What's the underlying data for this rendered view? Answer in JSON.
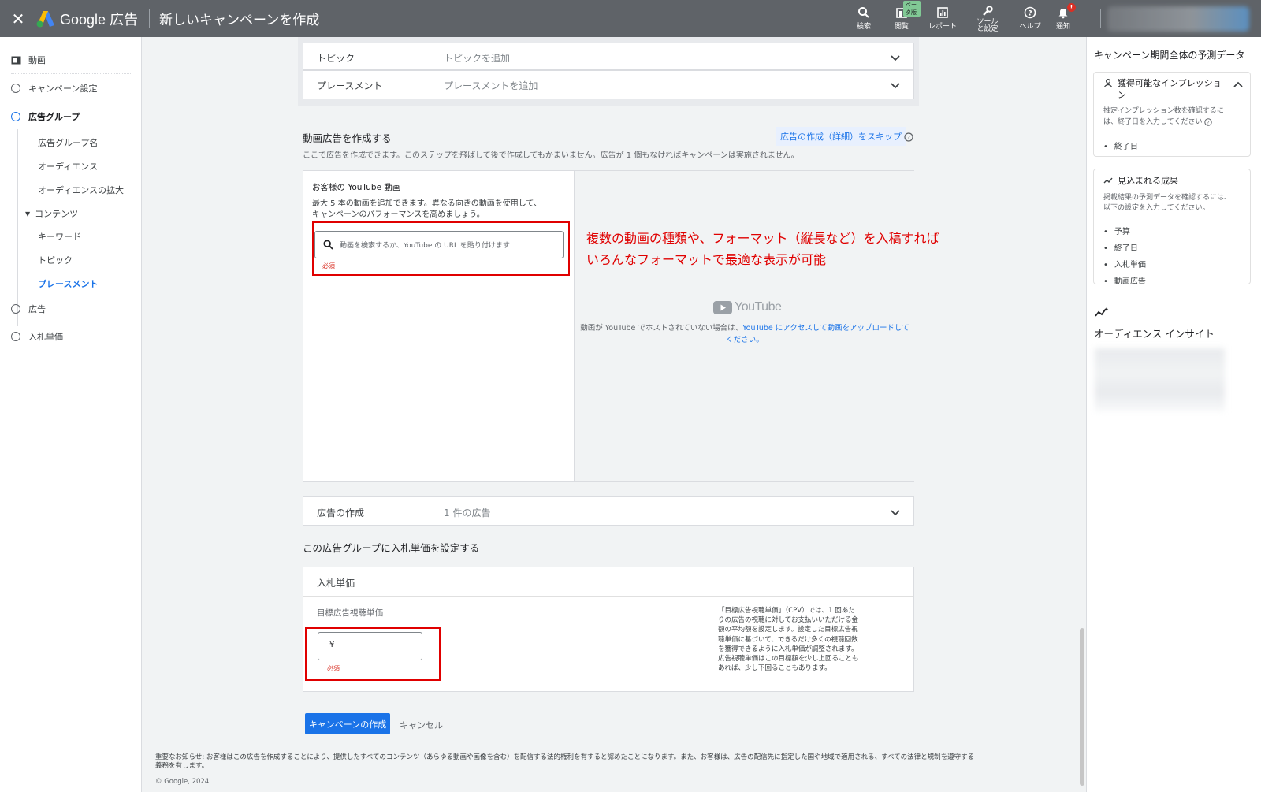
{
  "topbar": {
    "close": "✕",
    "brand": "Google 広告",
    "title": "新しいキャンペーンを作成",
    "icons": [
      {
        "icon": "search-icon",
        "label": "検索"
      },
      {
        "icon": "view-icon",
        "label": "閲覧",
        "badge": "ベータ版"
      },
      {
        "icon": "report-icon",
        "label": "レポート"
      },
      {
        "icon": "tools-icon",
        "label": "ツールと設定"
      },
      {
        "icon": "help-icon",
        "label": "ヘルプ"
      },
      {
        "icon": "bell-icon",
        "label": "通知",
        "badge": "!"
      }
    ]
  },
  "nav": {
    "video": "動画",
    "campaign_settings": "キャンペーン設定",
    "ad_group": "広告グループ",
    "ad_group_name": "広告グループ名",
    "audience": "オーディエンス",
    "audience_expansion": "オーディエンスの拡大",
    "content": "コンテンツ",
    "keywords": "キーワード",
    "topics": "トピック",
    "placements": "プレースメント",
    "ads": "広告",
    "bidding": "入札単価"
  },
  "content_rows": {
    "topic_label": "トピック",
    "topic_value": "トピックを追加",
    "placement_label": "プレースメント",
    "placement_value": "プレースメントを追加"
  },
  "video_ad": {
    "heading": "動画広告を作成する",
    "skip_link": "広告の作成（詳細）をスキップ",
    "description": "ここで広告を作成できます。このステップを飛ばして後で作成してもかまいません。広告が 1 個もなければキャンペーンは実施されません。",
    "yt_title": "お客様の YouTube 動画",
    "yt_desc_1": "最大 5 本の動画を追加できます。異なる向きの動画を使用して、",
    "yt_desc_2": "キャンペーンのパフォーマンスを高めましょう。",
    "search_placeholder": "動画を検索するか、YouTube の URL を貼り付けます",
    "required": "必須",
    "youtube_logo": "YouTube",
    "not_hosted_1": "動画が YouTube でホストされていない場合は、",
    "not_hosted_link_1": "YouTube にアクセスして動画をアップロードして",
    "not_hosted_link_2": "ください。"
  },
  "annotation": {
    "line1": "複数の動画の種類や、フォーマット（縦長など）を入稿すれば",
    "line2": "いろんなフォーマットで最適な表示が可能"
  },
  "ad_creation": {
    "label": "広告の作成",
    "value": "1 件の広告"
  },
  "bid": {
    "heading": "この広告グループに入札単価を設定する",
    "card_title": "入札単価",
    "target_label": "目標広告視聴単価",
    "currency": "¥",
    "required": "必須",
    "help_lines": [
      "「目標広告視聴単価」（CPV）では、1 回あた",
      "りの広告の視聴に対してお支払いいただける金",
      "額の平均額を設定します。設定した目標広告視",
      "聴単価に基づいて、できるだけ多くの視聴回数",
      "を獲得できるように入札単価が調整されます。",
      "広告視聴単価はこの目標額を少し上回ることも",
      "あれば、少し下回ることもあります。"
    ]
  },
  "actions": {
    "create": "キャンペーンの作成",
    "cancel": "キャンセル"
  },
  "footer": {
    "notice_1": "重要なお知らせ: お客様はこの広告を作成することにより、提供したすべてのコンテンツ（あらゆる動画や画像を含む）を配信する法的権利を有すると認めたことになります。また、お客様は、広告の配信先に指定した国や地域で適用される、すべての法律と規制を遵守する",
    "notice_2": "義務を有します。",
    "copyright": "© Google, 2024."
  },
  "right": {
    "title": "キャンペーン期間全体の予測データ",
    "impressions_title": "獲得可能なインプレッション",
    "impressions_desc_1": "推定インプレッション数を確認するに",
    "impressions_desc_2": "は、終了日を入力してください",
    "impressions_items": [
      "終了日"
    ],
    "results_title": "見込まれる成果",
    "results_desc_1": "掲載結果の予測データを確認するには、",
    "results_desc_2": "以下の設定を入力してください。",
    "results_items": [
      "予算",
      "終了日",
      "入札単価",
      "動画広告"
    ],
    "insight_title": "オーディエンス インサイト"
  },
  "colors": {
    "topbar": "#5f6368",
    "accent": "#1a73e8",
    "annotation_red": "#e00000"
  }
}
